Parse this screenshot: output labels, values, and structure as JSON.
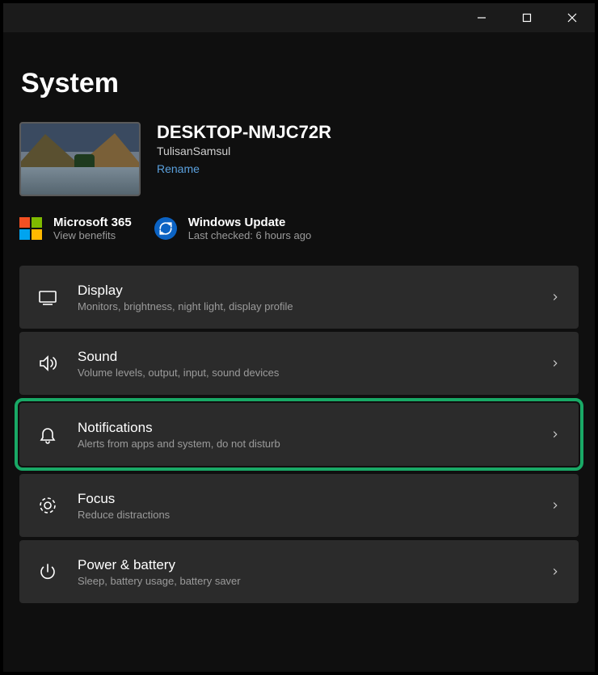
{
  "titlebar": {
    "minimize": "minimize",
    "maximize": "maximize",
    "close": "close"
  },
  "header": {
    "title": "System"
  },
  "device": {
    "name": "DESKTOP-NMJC72R",
    "subname": "TulisanSamsul",
    "rename_label": "Rename"
  },
  "tiles": {
    "ms365": {
      "title": "Microsoft 365",
      "desc": "View benefits"
    },
    "windows_update": {
      "title": "Windows Update",
      "desc": "Last checked: 6 hours ago"
    }
  },
  "settings": [
    {
      "id": "display",
      "title": "Display",
      "desc": "Monitors, brightness, night light, display profile",
      "highlight": false
    },
    {
      "id": "sound",
      "title": "Sound",
      "desc": "Volume levels, output, input, sound devices",
      "highlight": false
    },
    {
      "id": "notifications",
      "title": "Notifications",
      "desc": "Alerts from apps and system, do not disturb",
      "highlight": true
    },
    {
      "id": "focus",
      "title": "Focus",
      "desc": "Reduce distractions",
      "highlight": false
    },
    {
      "id": "power",
      "title": "Power & battery",
      "desc": "Sleep, battery usage, battery saver",
      "highlight": false
    }
  ]
}
